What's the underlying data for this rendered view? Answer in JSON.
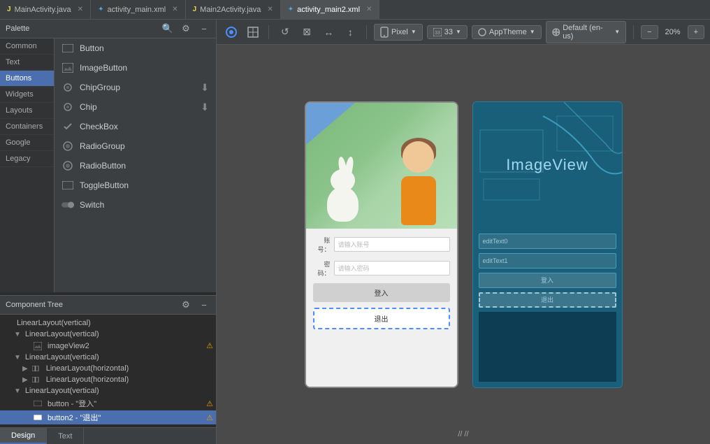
{
  "tabs": [
    {
      "id": "main-activity-java",
      "label": "MainActivity.java",
      "type": "java",
      "active": false
    },
    {
      "id": "activity-main-xml",
      "label": "activity_main.xml",
      "type": "xml",
      "active": false
    },
    {
      "id": "main2-activity-java",
      "label": "Main2Activity.java",
      "type": "java",
      "active": false
    },
    {
      "id": "activity-main2-xml",
      "label": "activity_main2.xml",
      "type": "xml",
      "active": true
    }
  ],
  "palette": {
    "title": "Palette",
    "search_icon": "🔍",
    "settings_icon": "⚙",
    "minimize_icon": "−",
    "sidebar_items": [
      {
        "id": "common",
        "label": "Common",
        "active": false
      },
      {
        "id": "text",
        "label": "Text",
        "active": false
      },
      {
        "id": "buttons",
        "label": "Buttons",
        "active": true
      },
      {
        "id": "widgets",
        "label": "Widgets",
        "active": false
      },
      {
        "id": "layouts",
        "label": "Layouts",
        "active": false
      },
      {
        "id": "containers",
        "label": "Containers",
        "active": false
      },
      {
        "id": "google",
        "label": "Google",
        "active": false
      },
      {
        "id": "legacy",
        "label": "Legacy",
        "active": false
      }
    ],
    "items": [
      {
        "id": "button",
        "label": "Button",
        "icon": "□",
        "download": false
      },
      {
        "id": "image-button",
        "label": "ImageButton",
        "icon": "🖼",
        "download": false
      },
      {
        "id": "chip-group",
        "label": "ChipGroup",
        "icon": "◎",
        "download": true
      },
      {
        "id": "chip",
        "label": "Chip",
        "icon": "◎",
        "download": true
      },
      {
        "id": "checkbox",
        "label": "CheckBox",
        "icon": "✓",
        "download": false
      },
      {
        "id": "radio-group",
        "label": "RadioGroup",
        "icon": "◉",
        "download": false
      },
      {
        "id": "radio-button",
        "label": "RadioButton",
        "icon": "◉",
        "download": false
      },
      {
        "id": "toggle-button",
        "label": "ToggleButton",
        "icon": "□",
        "download": false
      },
      {
        "id": "switch",
        "label": "Switch",
        "icon": "⬛",
        "download": false
      }
    ]
  },
  "toolbar": {
    "design_view_icon": "◉",
    "blueprint_icon": "⊞",
    "force_refresh_icon": "↺",
    "clear_cache_icon": "⊠",
    "h_align_icon": "↔",
    "v_align_icon": "↕",
    "device": "Pixel",
    "api": "33",
    "theme": "AppTheme",
    "locale": "Default (en-us)",
    "zoom": "20%",
    "zoom_in_icon": "+",
    "zoom_out_icon": "−"
  },
  "component_tree": {
    "title": "Component Tree",
    "settings_icon": "⚙",
    "minimize_icon": "−",
    "items": [
      {
        "id": "ll-vertical-root",
        "label": "LinearLayout(vertical)",
        "indent": 0,
        "expand": "",
        "icon": "",
        "warning": false
      },
      {
        "id": "ll-vertical-1",
        "label": "LinearLayout(vertical)",
        "indent": 1,
        "expand": "▶",
        "icon": "",
        "warning": false
      },
      {
        "id": "image-view2",
        "label": "imageView2",
        "indent": 2,
        "expand": "",
        "icon": "🖼",
        "warning": true
      },
      {
        "id": "ll-vertical-2",
        "label": "LinearLayout(vertical)",
        "indent": 1,
        "expand": "",
        "icon": "",
        "warning": false
      },
      {
        "id": "ll-horizontal-1",
        "label": "LinearLayout(horizontal)",
        "indent": 2,
        "expand": "▶",
        "icon": "",
        "warning": false
      },
      {
        "id": "ll-horizontal-2",
        "label": "LinearLayout(horizontal)",
        "indent": 2,
        "expand": "▶",
        "icon": "",
        "warning": false
      },
      {
        "id": "ll-vertical-3",
        "label": "LinearLayout(vertical)",
        "indent": 1,
        "expand": "",
        "icon": "",
        "warning": false
      },
      {
        "id": "button-login",
        "label": "button - \"登入\"",
        "indent": 2,
        "expand": "",
        "icon": "□",
        "warning": true
      },
      {
        "id": "button2-logout",
        "label": "button2 - \"退出\"",
        "indent": 2,
        "expand": "",
        "icon": "■",
        "warning": true,
        "selected": true
      }
    ]
  },
  "bottom_tabs": [
    {
      "id": "design",
      "label": "Design",
      "active": true
    },
    {
      "id": "text",
      "label": "Text",
      "active": false
    }
  ],
  "phone_form": {
    "account_label": "账 号：",
    "account_placeholder": "请输入账号",
    "password_label": "密 码：",
    "password_placeholder": "请输入密码",
    "login_btn": "登入",
    "logout_btn": "退出"
  },
  "blueprint": {
    "image_view_text": "ImageView",
    "edit_text1": "editText0",
    "edit_text2": "editText1",
    "login_btn": "登入",
    "logout_btn": "退出"
  }
}
